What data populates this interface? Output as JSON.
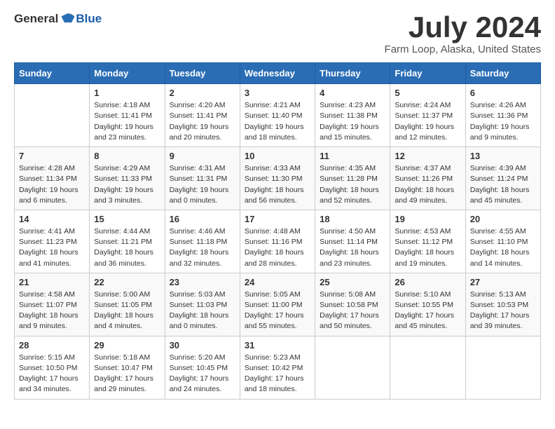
{
  "header": {
    "logo_general": "General",
    "logo_blue": "Blue",
    "month_title": "July 2024",
    "location": "Farm Loop, Alaska, United States"
  },
  "days_of_week": [
    "Sunday",
    "Monday",
    "Tuesday",
    "Wednesday",
    "Thursday",
    "Friday",
    "Saturday"
  ],
  "weeks": [
    [
      {
        "day": "",
        "info": ""
      },
      {
        "day": "1",
        "info": "Sunrise: 4:18 AM\nSunset: 11:41 PM\nDaylight: 19 hours\nand 23 minutes."
      },
      {
        "day": "2",
        "info": "Sunrise: 4:20 AM\nSunset: 11:41 PM\nDaylight: 19 hours\nand 20 minutes."
      },
      {
        "day": "3",
        "info": "Sunrise: 4:21 AM\nSunset: 11:40 PM\nDaylight: 19 hours\nand 18 minutes."
      },
      {
        "day": "4",
        "info": "Sunrise: 4:23 AM\nSunset: 11:38 PM\nDaylight: 19 hours\nand 15 minutes."
      },
      {
        "day": "5",
        "info": "Sunrise: 4:24 AM\nSunset: 11:37 PM\nDaylight: 19 hours\nand 12 minutes."
      },
      {
        "day": "6",
        "info": "Sunrise: 4:26 AM\nSunset: 11:36 PM\nDaylight: 19 hours\nand 9 minutes."
      }
    ],
    [
      {
        "day": "7",
        "info": "Sunrise: 4:28 AM\nSunset: 11:34 PM\nDaylight: 19 hours\nand 6 minutes."
      },
      {
        "day": "8",
        "info": "Sunrise: 4:29 AM\nSunset: 11:33 PM\nDaylight: 19 hours\nand 3 minutes."
      },
      {
        "day": "9",
        "info": "Sunrise: 4:31 AM\nSunset: 11:31 PM\nDaylight: 19 hours\nand 0 minutes."
      },
      {
        "day": "10",
        "info": "Sunrise: 4:33 AM\nSunset: 11:30 PM\nDaylight: 18 hours\nand 56 minutes."
      },
      {
        "day": "11",
        "info": "Sunrise: 4:35 AM\nSunset: 11:28 PM\nDaylight: 18 hours\nand 52 minutes."
      },
      {
        "day": "12",
        "info": "Sunrise: 4:37 AM\nSunset: 11:26 PM\nDaylight: 18 hours\nand 49 minutes."
      },
      {
        "day": "13",
        "info": "Sunrise: 4:39 AM\nSunset: 11:24 PM\nDaylight: 18 hours\nand 45 minutes."
      }
    ],
    [
      {
        "day": "14",
        "info": "Sunrise: 4:41 AM\nSunset: 11:23 PM\nDaylight: 18 hours\nand 41 minutes."
      },
      {
        "day": "15",
        "info": "Sunrise: 4:44 AM\nSunset: 11:21 PM\nDaylight: 18 hours\nand 36 minutes."
      },
      {
        "day": "16",
        "info": "Sunrise: 4:46 AM\nSunset: 11:18 PM\nDaylight: 18 hours\nand 32 minutes."
      },
      {
        "day": "17",
        "info": "Sunrise: 4:48 AM\nSunset: 11:16 PM\nDaylight: 18 hours\nand 28 minutes."
      },
      {
        "day": "18",
        "info": "Sunrise: 4:50 AM\nSunset: 11:14 PM\nDaylight: 18 hours\nand 23 minutes."
      },
      {
        "day": "19",
        "info": "Sunrise: 4:53 AM\nSunset: 11:12 PM\nDaylight: 18 hours\nand 19 minutes."
      },
      {
        "day": "20",
        "info": "Sunrise: 4:55 AM\nSunset: 11:10 PM\nDaylight: 18 hours\nand 14 minutes."
      }
    ],
    [
      {
        "day": "21",
        "info": "Sunrise: 4:58 AM\nSunset: 11:07 PM\nDaylight: 18 hours\nand 9 minutes."
      },
      {
        "day": "22",
        "info": "Sunrise: 5:00 AM\nSunset: 11:05 PM\nDaylight: 18 hours\nand 4 minutes."
      },
      {
        "day": "23",
        "info": "Sunrise: 5:03 AM\nSunset: 11:03 PM\nDaylight: 18 hours\nand 0 minutes."
      },
      {
        "day": "24",
        "info": "Sunrise: 5:05 AM\nSunset: 11:00 PM\nDaylight: 17 hours\nand 55 minutes."
      },
      {
        "day": "25",
        "info": "Sunrise: 5:08 AM\nSunset: 10:58 PM\nDaylight: 17 hours\nand 50 minutes."
      },
      {
        "day": "26",
        "info": "Sunrise: 5:10 AM\nSunset: 10:55 PM\nDaylight: 17 hours\nand 45 minutes."
      },
      {
        "day": "27",
        "info": "Sunrise: 5:13 AM\nSunset: 10:53 PM\nDaylight: 17 hours\nand 39 minutes."
      }
    ],
    [
      {
        "day": "28",
        "info": "Sunrise: 5:15 AM\nSunset: 10:50 PM\nDaylight: 17 hours\nand 34 minutes."
      },
      {
        "day": "29",
        "info": "Sunrise: 5:18 AM\nSunset: 10:47 PM\nDaylight: 17 hours\nand 29 minutes."
      },
      {
        "day": "30",
        "info": "Sunrise: 5:20 AM\nSunset: 10:45 PM\nDaylight: 17 hours\nand 24 minutes."
      },
      {
        "day": "31",
        "info": "Sunrise: 5:23 AM\nSunset: 10:42 PM\nDaylight: 17 hours\nand 18 minutes."
      },
      {
        "day": "",
        "info": ""
      },
      {
        "day": "",
        "info": ""
      },
      {
        "day": "",
        "info": ""
      }
    ]
  ]
}
